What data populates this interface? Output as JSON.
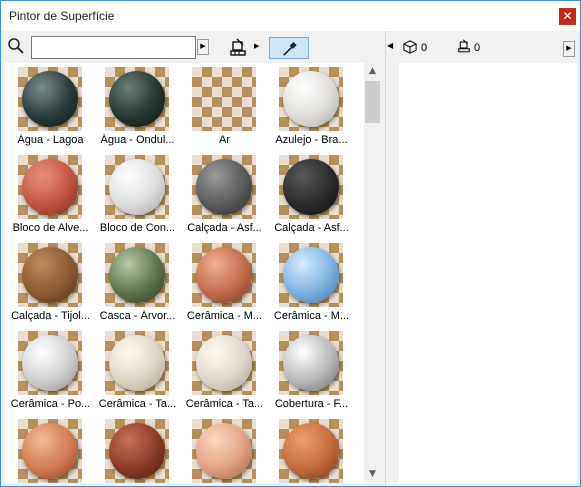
{
  "window": {
    "title": "Pintor de Superfície",
    "close_glyph": "✕"
  },
  "toolbar": {
    "search_value": "",
    "search_placeholder": "",
    "expand_arrow_glyph": "▶",
    "brush_arrow_glyph": "▶"
  },
  "panel_toggle_glyph": "◀",
  "scrollbar": {
    "up_glyph": "▲",
    "down_glyph": "▼"
  },
  "materials": [
    {
      "label": "Água - Lagoa",
      "colors": [
        "#7a8c88",
        "#2a3a3a",
        "#0d1616"
      ]
    },
    {
      "label": "Água - Ondul...",
      "colors": [
        "#6a8078",
        "#26352f",
        "#0b1410"
      ]
    },
    {
      "label": "Ar",
      "colors": []
    },
    {
      "label": "Azulejo - Bra...",
      "colors": [
        "#ffffff",
        "#dedcd8",
        "#a8a6a2"
      ]
    },
    {
      "label": "Bloco de Alve...",
      "colors": [
        "#e8907a",
        "#c2553e",
        "#7a2a1e"
      ]
    },
    {
      "label": "Bloco de Con...",
      "colors": [
        "#ffffff",
        "#dcdcdc",
        "#9a9a9a"
      ]
    },
    {
      "label": "Calçada - Asf...",
      "colors": [
        "#9a9a9a",
        "#5a5a5a",
        "#2a2a2a"
      ]
    },
    {
      "label": "Calçada - Asf...",
      "colors": [
        "#5a5a5a",
        "#2a2a2a",
        "#0e0e0e"
      ]
    },
    {
      "label": "Calçada - Tijol...",
      "colors": [
        "#c08a5a",
        "#8a5a30",
        "#4a2e16"
      ]
    },
    {
      "label": "Casca - Árvor...",
      "colors": [
        "#b8c8a8",
        "#5e7250",
        "#27331f"
      ]
    },
    {
      "label": "Cerâmica - M...",
      "colors": [
        "#f0b090",
        "#c26a48",
        "#7a3a22"
      ]
    },
    {
      "label": "Cerâmica - M...",
      "colors": [
        "#d8ecff",
        "#7ab2e0",
        "#3a70a8"
      ]
    },
    {
      "label": "Cerâmica - Po...",
      "colors": [
        "#ffffff",
        "#cfcfcf",
        "#8a8a8a"
      ]
    },
    {
      "label": "Cerâmica - Ta...",
      "colors": [
        "#fffaf0",
        "#ddd4c6",
        "#a39a8c"
      ]
    },
    {
      "label": "Cerâmica - Ta...",
      "colors": [
        "#fffaf0",
        "#ddd6ca",
        "#a39c90"
      ]
    },
    {
      "label": "Cobertura - F...",
      "colors": [
        "#ffffff",
        "#b8b8b8",
        "#6a6a6a"
      ]
    },
    {
      "label": "",
      "colors": [
        "#f5b890",
        "#d07a50",
        "#8a4020"
      ]
    },
    {
      "label": "",
      "colors": [
        "#c8705a",
        "#8a3a28",
        "#4a1a10"
      ]
    },
    {
      "label": "",
      "colors": [
        "#ffd8c0",
        "#e0a080",
        "#a06040"
      ]
    },
    {
      "label": "",
      "colors": [
        "#f0a070",
        "#c26a3a",
        "#7a3a18"
      ]
    }
  ],
  "right_panel": {
    "cube_count": "0",
    "brush_count": "0",
    "expand_glyph": "▶"
  },
  "icons": {
    "search": "search-icon",
    "brush": "paint-brush-icon",
    "eyedropper": "eyedropper-icon",
    "cube": "cube-icon"
  }
}
